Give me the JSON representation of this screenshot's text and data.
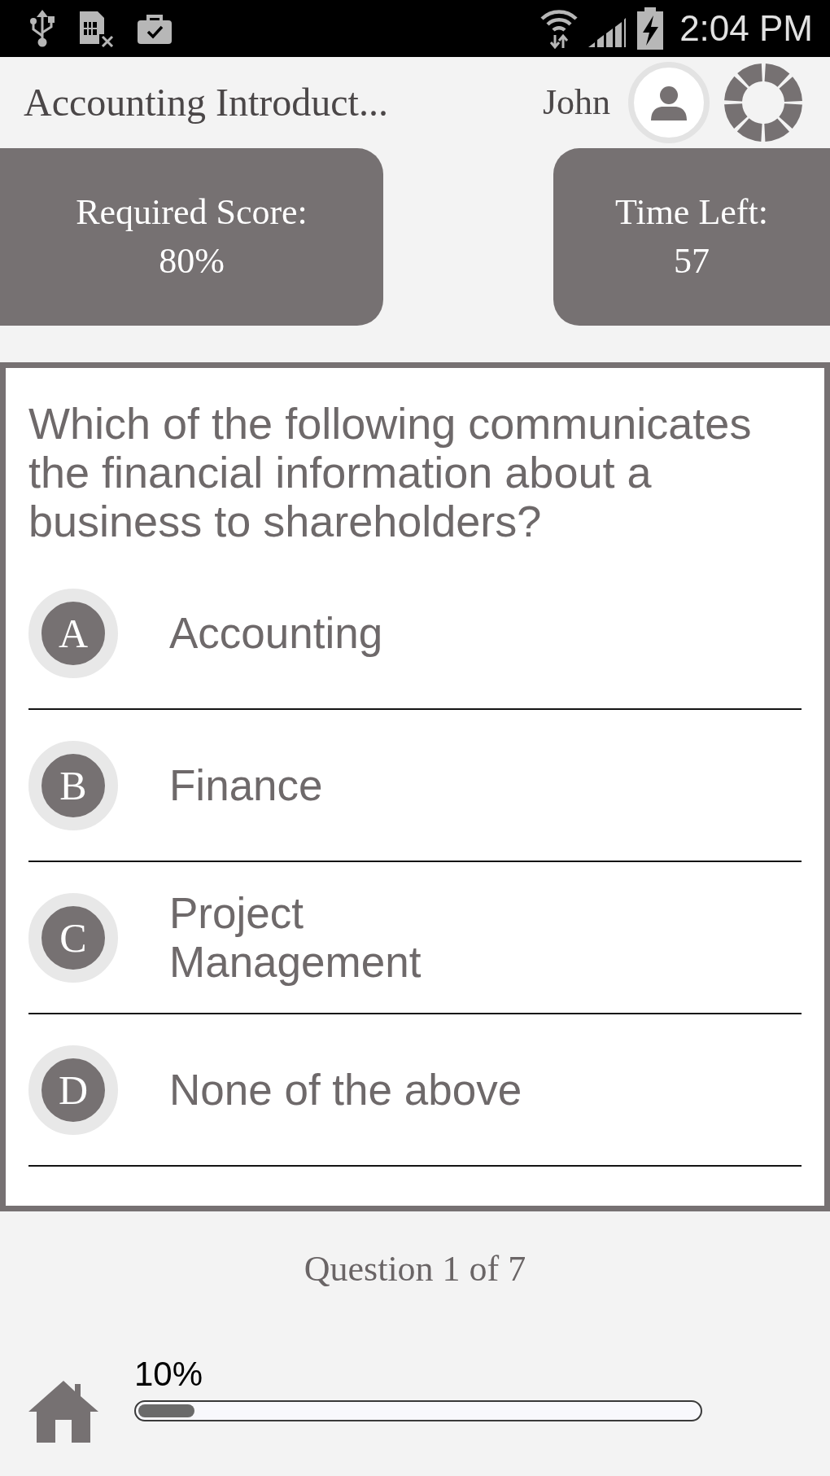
{
  "status_bar": {
    "time": "2:04 PM"
  },
  "header": {
    "title": "Accounting Introduct...",
    "user_name": "John"
  },
  "stats": [
    {
      "label": "Required Score:",
      "value": "80%"
    },
    {
      "label": "Time Left:",
      "value": "57"
    }
  ],
  "question": {
    "text": "Which of the following communicates the financial information about a business to shareholders?",
    "options": [
      {
        "letter": "A",
        "text": "Accounting",
        "selected": false
      },
      {
        "letter": "B",
        "text": "Finance",
        "selected": false
      },
      {
        "letter": "C",
        "text": "Project Management",
        "selected": false
      },
      {
        "letter": "D",
        "text": "None of the above",
        "selected": false
      }
    ]
  },
  "footer": {
    "question_counter": "Question 1 of 7",
    "progress": {
      "reading": "10%",
      "level": 0.1
    }
  }
}
